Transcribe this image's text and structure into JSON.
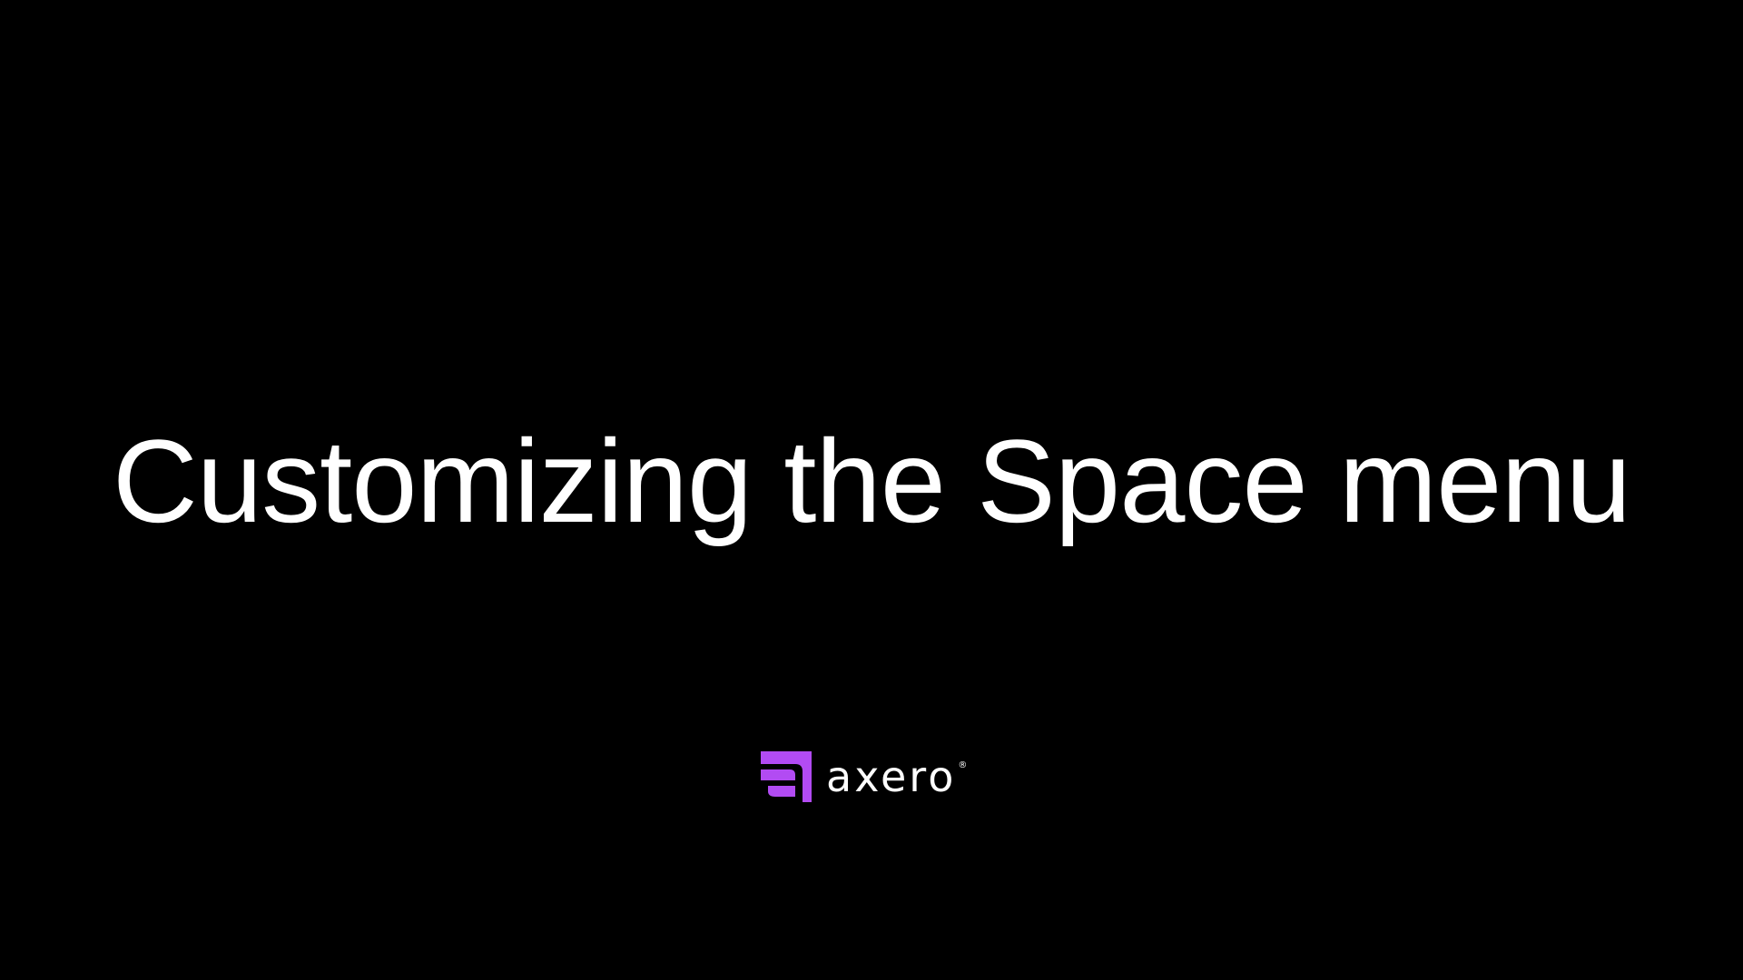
{
  "slide": {
    "title": "Customizing the Space menu",
    "background_color": "#000000",
    "text_color": "#ffffff"
  },
  "logo": {
    "icon": "axero-logo-mark-icon",
    "wordmark": "axero",
    "registered": "®",
    "brand_color": "#b24bf3"
  }
}
